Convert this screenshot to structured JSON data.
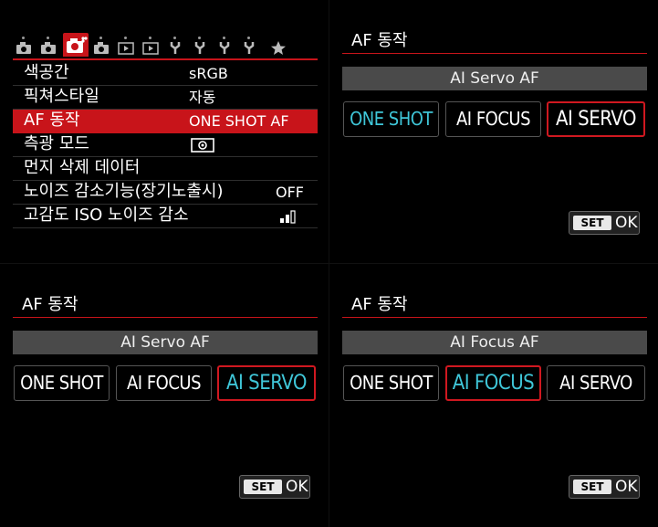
{
  "menu": {
    "tabs": [
      {
        "icon": "camera-tab-1-icon"
      },
      {
        "icon": "camera-tab-2-icon"
      },
      {
        "icon": "camera-tab-3-icon"
      },
      {
        "icon": "camera-tab-4-icon"
      },
      {
        "icon": "playback-tab-1-icon"
      },
      {
        "icon": "playback-tab-2-icon"
      },
      {
        "icon": "wrench-tab-1-icon"
      },
      {
        "icon": "wrench-tab-2-icon"
      },
      {
        "icon": "wrench-tab-3-icon"
      },
      {
        "icon": "wrench-tab-4-icon"
      },
      {
        "icon": "star-tab-icon"
      }
    ],
    "active_tab": 2,
    "items": [
      {
        "label": "색공간",
        "value": "sRGB"
      },
      {
        "label": "픽쳐스타일",
        "value": "자동"
      },
      {
        "label": "AF 동작",
        "value": "ONE SHOT AF"
      },
      {
        "label": "측광 모드",
        "value": ""
      },
      {
        "label": "먼지 삭제 데이터",
        "value": ""
      },
      {
        "label": "노이즈 감소기능(장기노출시)",
        "value": "OFF"
      },
      {
        "label": "고감도 ISO 노이즈 감소",
        "value": ""
      }
    ],
    "selected_item": 2
  },
  "screens": [
    {
      "title": "AF 동작",
      "current": "AI Servo AF",
      "options": [
        "ONE SHOT",
        "AI FOCUS",
        "AI SERVO"
      ],
      "highlighted_option": "ONE SHOT",
      "selected_option": "AI SERVO",
      "set_label": "SET",
      "ok_label": "OK"
    },
    {
      "title": "AF 동작",
      "current": "AI Servo AF",
      "options": [
        "ONE SHOT",
        "AI FOCUS",
        "AI SERVO"
      ],
      "highlighted_option": "AI SERVO",
      "selected_option": "AI SERVO",
      "set_label": "SET",
      "ok_label": "OK"
    },
    {
      "title": "AF 동작",
      "current": "AI Focus AF",
      "options": [
        "ONE SHOT",
        "AI FOCUS",
        "AI SERVO"
      ],
      "highlighted_option": "AI FOCUS",
      "selected_option": "AI FOCUS",
      "set_label": "SET",
      "ok_label": "OK"
    }
  ],
  "colors": {
    "accent_red": "#c8141a",
    "highlight_cyan": "#3fc6d8",
    "background": "#000000"
  }
}
